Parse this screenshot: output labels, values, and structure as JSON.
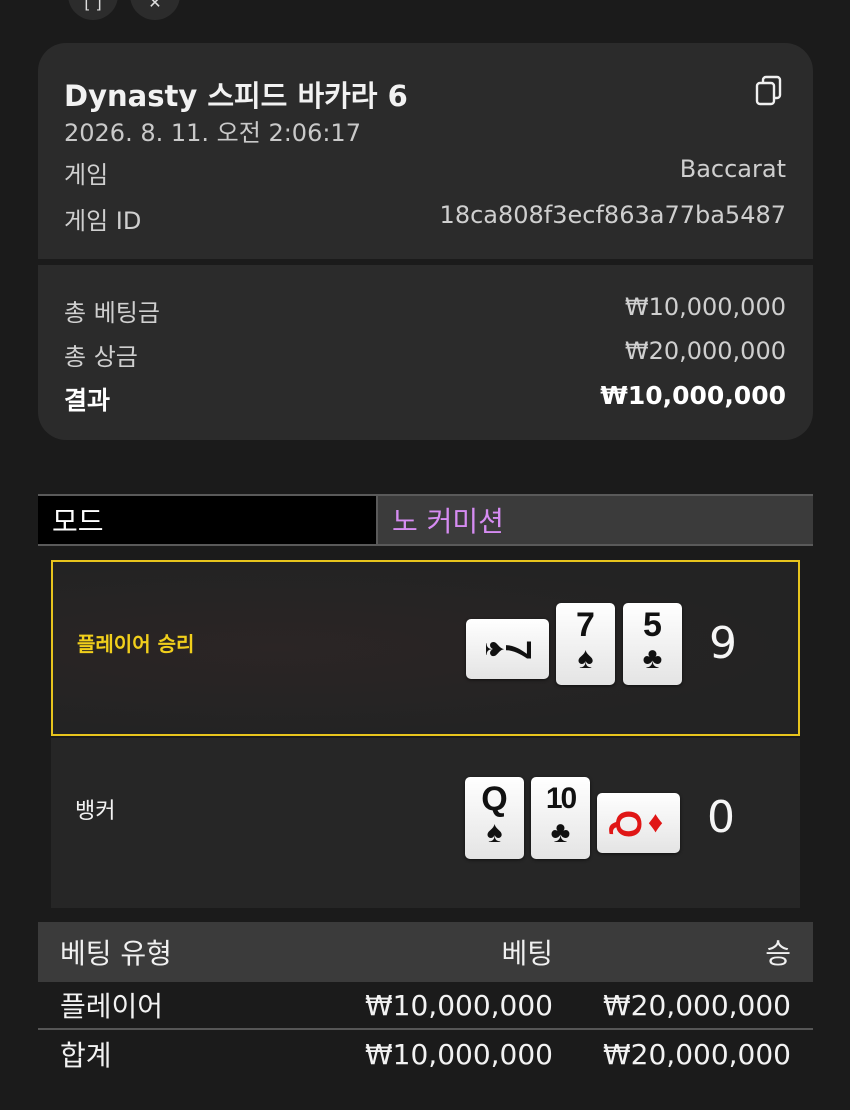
{
  "top_icons": [
    "expand-icon",
    "close-icon"
  ],
  "summary": {
    "title": "Dynasty 스피드 바카라 6",
    "datetime": "2026. 8. 11. 오전 2:06:17",
    "game_label": "게임",
    "game_value": "Baccarat",
    "game_id_label": "게임 ID",
    "game_id_value": "18ca808f3ecf863a77ba5487",
    "total_bet_label": "총 베팅금",
    "total_bet_value": "₩10,000,000",
    "total_win_label": "총 상금",
    "total_win_value": "₩20,000,000",
    "result_label": "결과",
    "result_value": "₩10,000,000"
  },
  "mode": {
    "label": "모드",
    "value": "노 커미션"
  },
  "hands": {
    "player": {
      "label": "플레이어 승리",
      "score": "9",
      "cards": [
        {
          "rank": "7",
          "suit": "♠",
          "color": "#111111",
          "orientation": "horizontal"
        },
        {
          "rank": "7",
          "suit": "♠",
          "color": "#111111",
          "orientation": "vertical"
        },
        {
          "rank": "5",
          "suit": "♣",
          "color": "#111111",
          "orientation": "vertical"
        }
      ]
    },
    "banker": {
      "label": "뱅커",
      "score": "0",
      "cards": [
        {
          "rank": "Q",
          "suit": "♠",
          "color": "#111111",
          "orientation": "vertical"
        },
        {
          "rank": "10",
          "suit": "♣",
          "color": "#111111",
          "orientation": "vertical"
        },
        {
          "rank": "Q",
          "suit": "♦",
          "color": "#e01616",
          "orientation": "horizontal"
        }
      ]
    }
  },
  "bets": {
    "headers": {
      "type": "베팅 유형",
      "bet": "베팅",
      "win": "승"
    },
    "rows": [
      {
        "type": "플레이어",
        "bet": "₩10,000,000",
        "win": "₩20,000,000"
      }
    ],
    "total": {
      "type": "합계",
      "bet": "₩10,000,000",
      "win": "₩20,000,000"
    }
  },
  "colors": {
    "accent_yellow": "#e7c41d",
    "mode_purple": "#d68cf2",
    "card_red": "#e01616"
  }
}
